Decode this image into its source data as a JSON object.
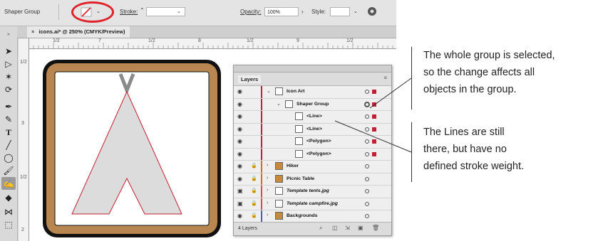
{
  "control_bar": {
    "selection_type": "Shaper Group",
    "stroke_label": "Stroke:",
    "stroke_value": "",
    "opacity_label": "Opacity:",
    "opacity_value": "100%",
    "style_label": "Style:"
  },
  "document_tab": {
    "title": "icons.ai* @ 250% (CMYK/Preview)"
  },
  "ruler": {
    "h_labels": [
      "1/2",
      "7",
      "1/2",
      "8",
      "1/2",
      "9",
      "1/2"
    ],
    "v_labels": [
      "1/2",
      "3",
      "1/2",
      "2"
    ]
  },
  "layers_panel": {
    "tab_label": "Layers",
    "layer_count": "4 Layers",
    "rows": [
      {
        "name": "Icon Art",
        "color": "#c22032"
      },
      {
        "name": "Shaper Group",
        "color": "#c22032"
      },
      {
        "name": "<Line>",
        "color": "#c22032"
      },
      {
        "name": "<Line>",
        "color": "#c22032"
      },
      {
        "name": "<Polygon>",
        "color": "#c22032"
      },
      {
        "name": "<Polygon>",
        "color": "#c22032"
      },
      {
        "name": "Hiker",
        "color": "#e06a10"
      },
      {
        "name": "Picnic Table",
        "color": "#e06a10"
      },
      {
        "name": "Template tents.jpg",
        "color": "#e04a3a"
      },
      {
        "name": "Template campfire.jpg",
        "color": "#e04a3a"
      },
      {
        "name": "Backgrounds",
        "color": "#3c62c8"
      }
    ]
  },
  "annotations": {
    "note1": [
      "The whole group is selected,",
      "so the change affects all",
      "objects in the group."
    ],
    "note2": [
      "The Lines are still",
      "there, but have no",
      "defined stroke weight."
    ]
  },
  "colors": {
    "highlight_circle": "#e0222a",
    "frame": "#b88650",
    "tent_fill": "#dcdcdc",
    "tent_stroke": "#c22032",
    "pole": "#8a8a8a"
  }
}
